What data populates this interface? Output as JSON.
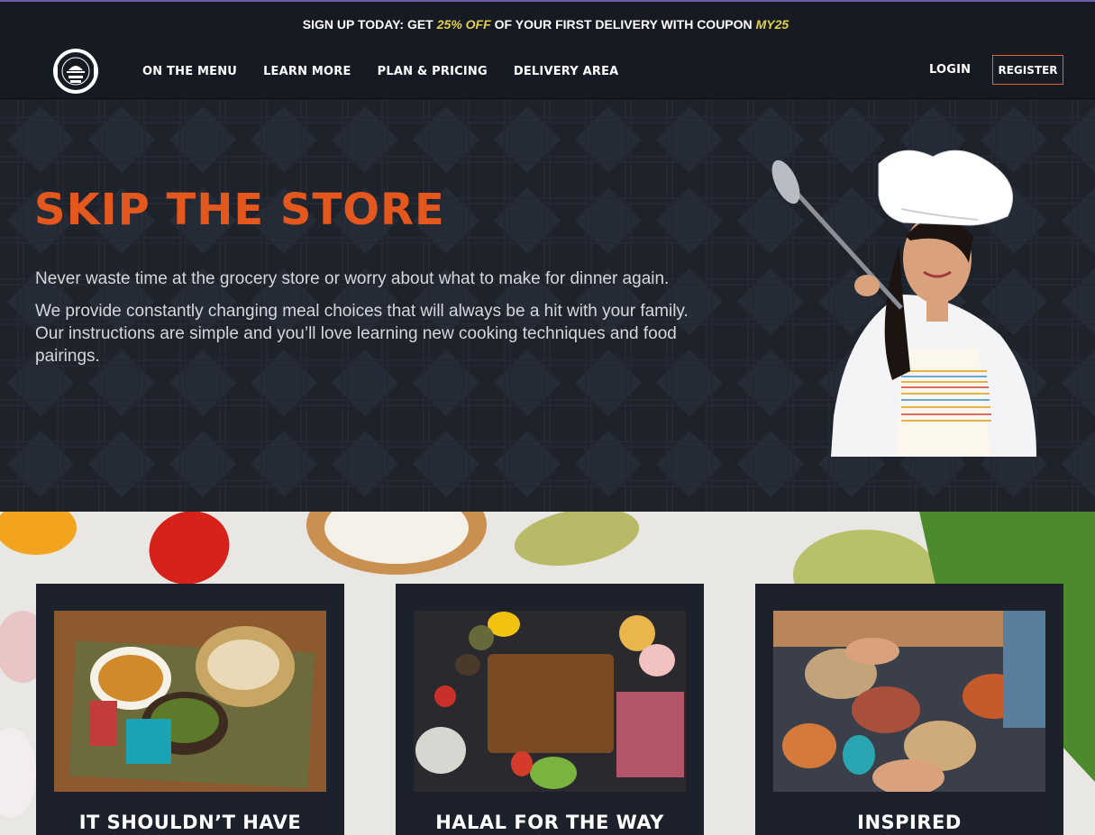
{
  "promo": {
    "prefix": "SIGN UP TODAY: GET",
    "discount": "25% OFF",
    "middle": "OF YOUR FIRST DELIVERY WITH COUPON",
    "coupon": "MY25"
  },
  "nav": {
    "links": [
      "ON THE MENU",
      "LEARN MORE",
      "PLAN & PRICING",
      "DELIVERY AREA"
    ],
    "login": "LOGIN",
    "register": "REGISTER"
  },
  "hero": {
    "title": "SKIP THE STORE",
    "para1": "Never waste time at the grocery store or worry about what to make for dinner again.",
    "para2": "We provide constantly changing meal choices that will always be a hit with your family. Our instructions are simple and you’ll love learning new cooking techniques and food pairings."
  },
  "cards": [
    {
      "title": "IT SHOULDN’T HAVE"
    },
    {
      "title": "HALAL FOR THE WAY"
    },
    {
      "title": "INSPIRED"
    }
  ],
  "colors": {
    "accent": "#e4581e",
    "coupon": "#e3d04c",
    "dark": "#161a22"
  }
}
